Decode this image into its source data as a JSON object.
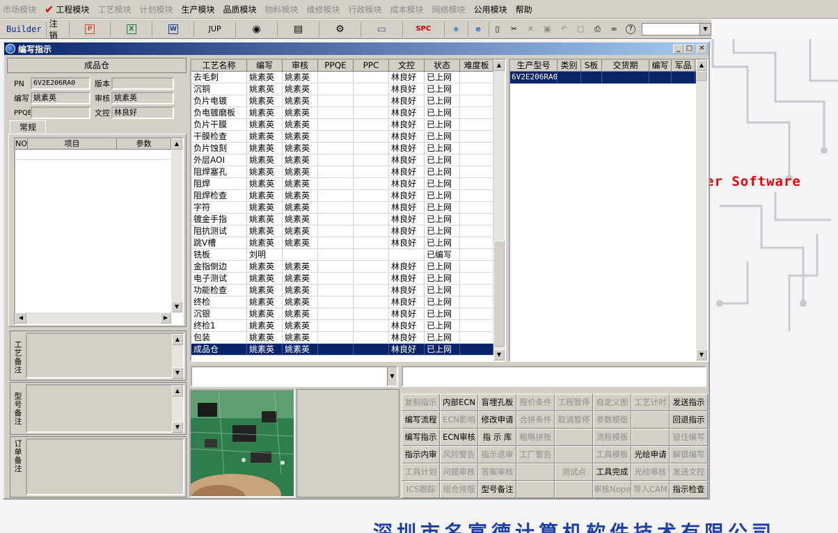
{
  "menu": [
    {
      "label": "市场模块",
      "enabled": false,
      "checked": false
    },
    {
      "label": "工程模块",
      "enabled": true,
      "checked": true
    },
    {
      "label": "工艺模块",
      "enabled": false,
      "checked": false
    },
    {
      "label": "计划模块",
      "enabled": false,
      "checked": false
    },
    {
      "label": "生产模块",
      "enabled": true,
      "checked": false
    },
    {
      "label": "品质模块",
      "enabled": true,
      "checked": false
    },
    {
      "label": "物料模块",
      "enabled": false,
      "checked": false
    },
    {
      "label": "维修模块",
      "enabled": false,
      "checked": false
    },
    {
      "label": "行政模块",
      "enabled": false,
      "checked": false
    },
    {
      "label": "成本模块",
      "enabled": false,
      "checked": false
    },
    {
      "label": "网络模块",
      "enabled": false,
      "checked": false
    },
    {
      "label": "公用模块",
      "enabled": true,
      "checked": false
    },
    {
      "label": "帮助",
      "enabled": true,
      "checked": false
    }
  ],
  "toolbar": {
    "builder": "Builder",
    "logout": "注销",
    "jup": "JUP",
    "spc": "SPC",
    "icons": [
      "ppt-icon",
      "excel-icon",
      "word-icon",
      "jup-icon",
      "eye-icon",
      "database-icon",
      "connect-icon",
      "monitor-icon",
      "spc-icon",
      "box-icon",
      "ie-icon",
      "new-doc-icon",
      "cut-icon",
      "close-x-icon",
      "save-icon",
      "undo-icon",
      "preview-icon",
      "print-icon",
      "binoculars-icon",
      "help-icon"
    ]
  },
  "window": {
    "title": "编写指示"
  },
  "left": {
    "header": "成品仓",
    "pn_label": "PN",
    "pn_value": "6V2E206RA0",
    "version_label": "版本",
    "version_value": "",
    "writer_label": "编写",
    "writer_value": "姚素英",
    "review_label": "审核",
    "review_value": "姚素英",
    "ppqe_label": "PPQE",
    "ppqe_value": "",
    "docctl_label": "文控",
    "docctl_value": "林良好",
    "tab_label": "常规",
    "grid_headers": [
      "NO",
      "项目",
      "参数"
    ],
    "memo_craft": "工艺备注",
    "memo_model": "型号备注",
    "memo_order": "订单备注"
  },
  "process": {
    "headers": [
      "工艺名称",
      "编写",
      "审核",
      "PPQE",
      "PPC",
      "文控",
      "状态",
      "难度板"
    ],
    "rows": [
      [
        "去毛刺",
        "姚素英",
        "姚素英",
        "",
        "",
        "林良好",
        "已上网",
        ""
      ],
      [
        "沉铜",
        "姚素英",
        "姚素英",
        "",
        "",
        "林良好",
        "已上网",
        ""
      ],
      [
        "负片电镀",
        "姚素英",
        "姚素英",
        "",
        "",
        "林良好",
        "已上网",
        ""
      ],
      [
        "负电镀磨板",
        "姚素英",
        "姚素英",
        "",
        "",
        "林良好",
        "已上网",
        ""
      ],
      [
        "负片干膜",
        "姚素英",
        "姚素英",
        "",
        "",
        "林良好",
        "已上网",
        ""
      ],
      [
        "干膜检查",
        "姚素英",
        "姚素英",
        "",
        "",
        "林良好",
        "已上网",
        ""
      ],
      [
        "负片蚀刻",
        "姚素英",
        "姚素英",
        "",
        "",
        "林良好",
        "已上网",
        ""
      ],
      [
        "外层AOI",
        "姚素英",
        "姚素英",
        "",
        "",
        "林良好",
        "已上网",
        ""
      ],
      [
        "阻焊塞孔",
        "姚素英",
        "姚素英",
        "",
        "",
        "林良好",
        "已上网",
        ""
      ],
      [
        "阻焊",
        "姚素英",
        "姚素英",
        "",
        "",
        "林良好",
        "已上网",
        ""
      ],
      [
        "阻焊检查",
        "姚素英",
        "姚素英",
        "",
        "",
        "林良好",
        "已上网",
        ""
      ],
      [
        "字符",
        "姚素英",
        "姚素英",
        "",
        "",
        "林良好",
        "已上网",
        ""
      ],
      [
        "镀金手指",
        "姚素英",
        "姚素英",
        "",
        "",
        "林良好",
        "已上网",
        ""
      ],
      [
        "阻抗测试",
        "姚素英",
        "姚素英",
        "",
        "",
        "林良好",
        "已上网",
        ""
      ],
      [
        "跳V槽",
        "姚素英",
        "姚素英",
        "",
        "",
        "林良好",
        "已上网",
        ""
      ],
      [
        "铣板",
        "刘明",
        "",
        "",
        "",
        "",
        "已编写",
        ""
      ],
      [
        "金指倒边",
        "姚素英",
        "姚素英",
        "",
        "",
        "林良好",
        "已上网",
        ""
      ],
      [
        "电子测试",
        "姚素英",
        "姚素英",
        "",
        "",
        "林良好",
        "已上网",
        ""
      ],
      [
        "功能检查",
        "姚素英",
        "姚素英",
        "",
        "",
        "林良好",
        "已上网",
        ""
      ],
      [
        "终检",
        "姚素英",
        "姚素英",
        "",
        "",
        "林良好",
        "已上网",
        ""
      ],
      [
        "沉银",
        "姚素英",
        "姚素英",
        "",
        "",
        "林良好",
        "已上网",
        ""
      ],
      [
        "终检1",
        "姚素英",
        "姚素英",
        "",
        "",
        "林良好",
        "已上网",
        ""
      ],
      [
        "包装",
        "姚素英",
        "姚素英",
        "",
        "",
        "林良好",
        "已上网",
        ""
      ],
      [
        "成品仓",
        "姚素英",
        "姚素英",
        "",
        "",
        "林良好",
        "已上网",
        ""
      ]
    ],
    "selected_index": 23
  },
  "models": {
    "headers": [
      "生产型号",
      "类别",
      "S板",
      "交货期",
      "编写",
      "军品"
    ],
    "rows": [
      [
        "6V2E206RA0",
        "",
        "",
        "",
        "",
        ""
      ]
    ]
  },
  "buttons": [
    {
      "label": "复制指示",
      "enabled": false
    },
    {
      "label": "内部ECN",
      "enabled": true
    },
    {
      "label": "盲埋孔板",
      "enabled": true
    },
    {
      "label": "报价条件",
      "enabled": false
    },
    {
      "label": "工程暂停",
      "enabled": false
    },
    {
      "label": "自定义图",
      "enabled": false
    },
    {
      "label": "工艺计时",
      "enabled": false
    },
    {
      "label": "发送指示",
      "enabled": true
    },
    {
      "label": "编写流程",
      "enabled": true
    },
    {
      "label": "ECN影响",
      "enabled": false
    },
    {
      "label": "修改申请",
      "enabled": true
    },
    {
      "label": "合拼条件",
      "enabled": false
    },
    {
      "label": "取消暂停",
      "enabled": false
    },
    {
      "label": "参数模板",
      "enabled": false
    },
    {
      "label": "",
      "enabled": false
    },
    {
      "label": "回退指示",
      "enabled": true
    },
    {
      "label": "编写指示",
      "enabled": true
    },
    {
      "label": "ECN审核",
      "enabled": true
    },
    {
      "label": "指 示 库",
      "enabled": true
    },
    {
      "label": "粗略拼板",
      "enabled": false
    },
    {
      "label": "",
      "enabled": false
    },
    {
      "label": "流程模板",
      "enabled": false
    },
    {
      "label": "",
      "enabled": false
    },
    {
      "label": "锁住编写",
      "enabled": false
    },
    {
      "label": "指示内审",
      "enabled": true
    },
    {
      "label": "风险警告",
      "enabled": false
    },
    {
      "label": "指示退审",
      "enabled": false
    },
    {
      "label": "工厂警告",
      "enabled": false
    },
    {
      "label": "",
      "enabled": false
    },
    {
      "label": "工具模板",
      "enabled": false
    },
    {
      "label": "光绘申请",
      "enabled": true
    },
    {
      "label": "解锁编写",
      "enabled": false
    },
    {
      "label": "工具计划",
      "enabled": false
    },
    {
      "label": "问题审核",
      "enabled": false
    },
    {
      "label": "答案审核",
      "enabled": false
    },
    {
      "label": "",
      "enabled": false
    },
    {
      "label": "测试点",
      "enabled": false
    },
    {
      "label": "工具完成",
      "enabled": true
    },
    {
      "label": "光绘审核",
      "enabled": false
    },
    {
      "label": "发送文控",
      "enabled": false
    },
    {
      "label": "ICS跟踪",
      "enabled": false
    },
    {
      "label": "组合排版",
      "enabled": false
    },
    {
      "label": "型号备注",
      "enabled": true
    },
    {
      "label": "",
      "enabled": false
    },
    {
      "label": "",
      "enabled": false
    },
    {
      "label": "审核Nope",
      "enabled": false
    },
    {
      "label": "导入CAM",
      "enabled": false
    },
    {
      "label": "指示检查",
      "enabled": true
    }
  ],
  "desktop": {
    "brand": "er Software",
    "company": "深圳市名富德计算机软件技术有限公司"
  },
  "colors": {
    "selection": "#0a246a",
    "titlebar": "#0a246a",
    "brand": "#e60000",
    "face": "#d4d0c8"
  }
}
